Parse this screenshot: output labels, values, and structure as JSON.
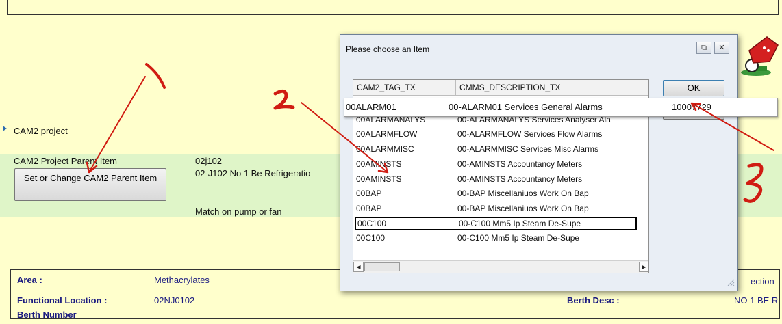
{
  "form": {
    "section_title": "CAM2 project",
    "parent_item_label": "CAM2 Project Parent Item",
    "parent_item_code": "02j102",
    "parent_item_desc": "02-J102  No 1 Be Refrigeratio",
    "set_button_label": "Set or Change CAM2 Parent Item",
    "match_note": "Match on pump or fan",
    "area_label": "Area :",
    "area_value": "Methacrylates",
    "area_value_right": "ection",
    "functional_location_label": "Functional Location :",
    "functional_location_value": "02NJ0102",
    "berth_desc_label": "Berth Desc :",
    "berth_desc_value": "NO 1 BE R",
    "berth_number_label": "Berth Number"
  },
  "dialog": {
    "title": "Please choose an Item",
    "restore_icon": "restore-icon",
    "close_icon": "close-icon",
    "ok_label": "OK",
    "columns": [
      "CAM2_TAG_TX",
      "CMMS_DESCRIPTION_TX"
    ],
    "rows": [
      {
        "tag": "00ALARM01",
        "desc": "00-ALARM01  Services General Alarms"
      },
      {
        "tag": "00ALARMANALYS",
        "desc": "00-ALARMANALYS  Services Analyser Ala"
      },
      {
        "tag": "00ALARMFLOW",
        "desc": "00-ALARMFLOW  Services Flow Alarms"
      },
      {
        "tag": "00ALARMMISC",
        "desc": "00-ALARMMISC  Services Misc Alarms"
      },
      {
        "tag": "00AMINSTS",
        "desc": "00-AMINSTS  Accountancy Meters"
      },
      {
        "tag": "00AMINSTS",
        "desc": "00-AMINSTS  Accountancy Meters"
      },
      {
        "tag": "00BAP",
        "desc": "00-BAP  Miscellaniuos Work On Bap"
      },
      {
        "tag": "00BAP",
        "desc": "00-BAP  Miscellaniuos Work On Bap"
      },
      {
        "tag": "00C100",
        "desc": "00-C100  Mm5 Ip Steam De-Supe"
      },
      {
        "tag": "00C100",
        "desc": "00-C100  Mm5 Ip Steam De-Supe"
      }
    ],
    "selected_row_index": 8,
    "floating_row": {
      "tag": "00ALARM01",
      "desc": "00-ALARM01  Services General Alarms",
      "id": "10007729"
    }
  },
  "annotations": {
    "step1": "1",
    "step2": "2",
    "step3": "3",
    "color": "#d01c12"
  },
  "colors": {
    "background": "#ffffcc",
    "band": "#dff5c8",
    "dialog": "#e9eef5"
  }
}
